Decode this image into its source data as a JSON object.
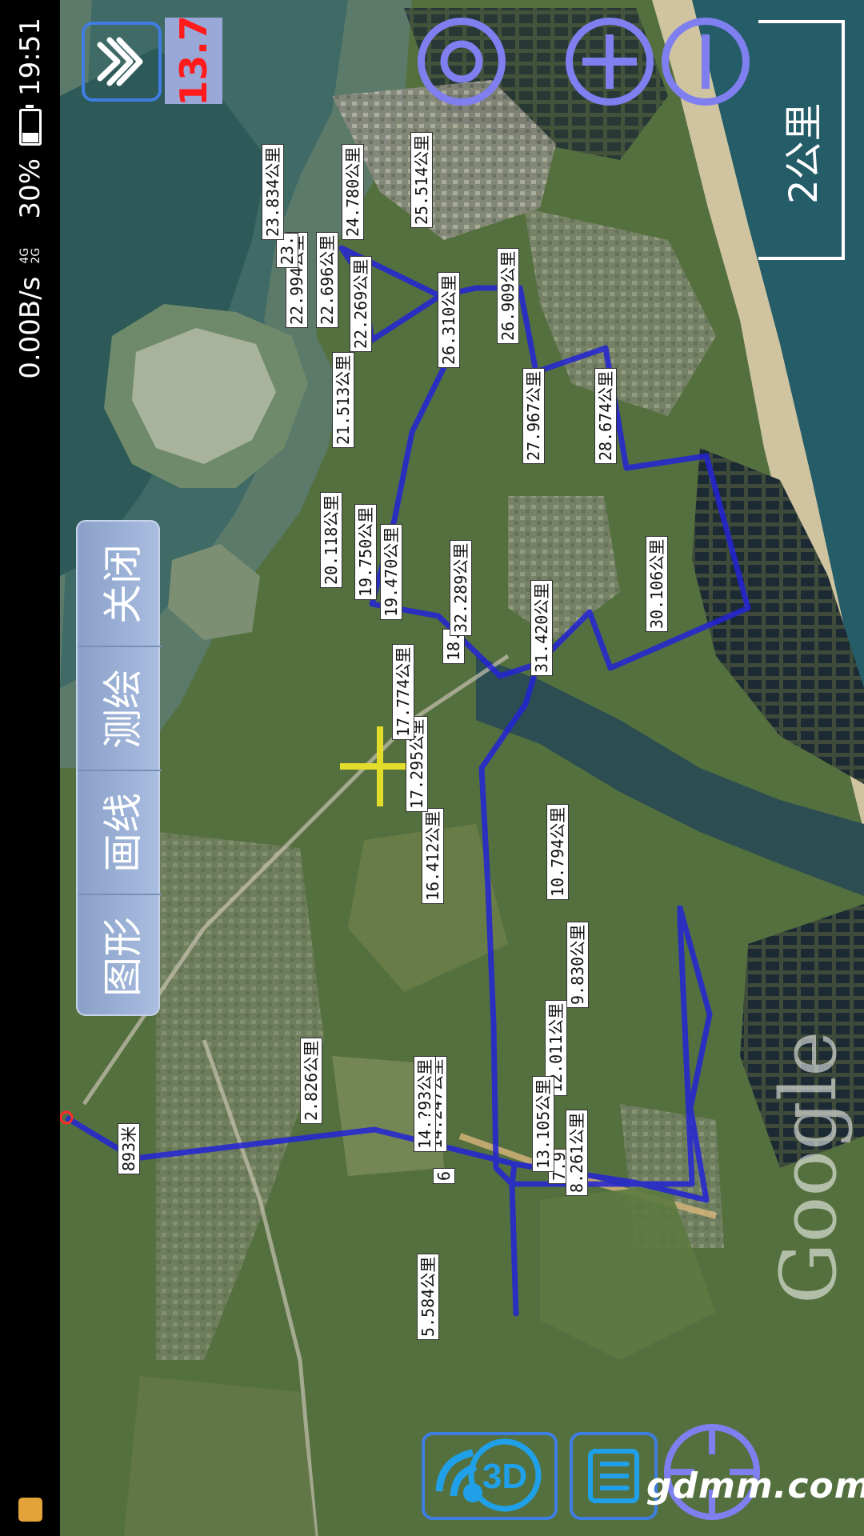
{
  "status_bar": {
    "net_speed": "0.00B/s",
    "signal": "4G 2G",
    "battery_pct": "30%",
    "battery_level": 0.3,
    "time": "19:51",
    "app_icon": "app-notification-icon"
  },
  "map_controls": {
    "layers_icon": "layers-icon",
    "zoom_level": "13.7",
    "target_icon": "target-icon",
    "zoom_in_icon": "plus-icon",
    "zoom_out_icon": "minus-icon",
    "scale_label": "2公里"
  },
  "mode_menu": [
    "关闭",
    "测绘",
    "画线",
    "图形"
  ],
  "route_labels": [
    "893米",
    "2.826公里",
    "5.584公里",
    "6",
    "7.9",
    "8.261公里",
    "9.830公里",
    "10.794公里",
    "12.011公里",
    "13.105公里",
    "14.247公里",
    "14.?93公里",
    "16.412公里",
    "17.295公里",
    "17.774公里",
    "18.",
    "19.470公里",
    "19.750公里",
    "20.118公里",
    "21.513公里",
    "22.269公里",
    "22.696公里",
    "22.994公里",
    "23.",
    "23.834公里",
    "24.780公里",
    "25.514公里",
    "26.310公里",
    "26.909公里",
    "27.967公里",
    "28.674公里",
    "30.106公里",
    "31.420公里",
    "32.289公里"
  ],
  "bottom_bar": {
    "btn_3d_label": "3D",
    "list_icon": "list-icon",
    "locate_icon": "crosshair-locate-icon",
    "watermark": "gdmm.com",
    "google_logo": "Google"
  },
  "colors": {
    "route": "#2323d6",
    "control_accent": "#7f7ff0",
    "control_border": "#3f7de3",
    "zoom_text": "#ff1b1b",
    "crosshair": "#e4dc2a"
  }
}
